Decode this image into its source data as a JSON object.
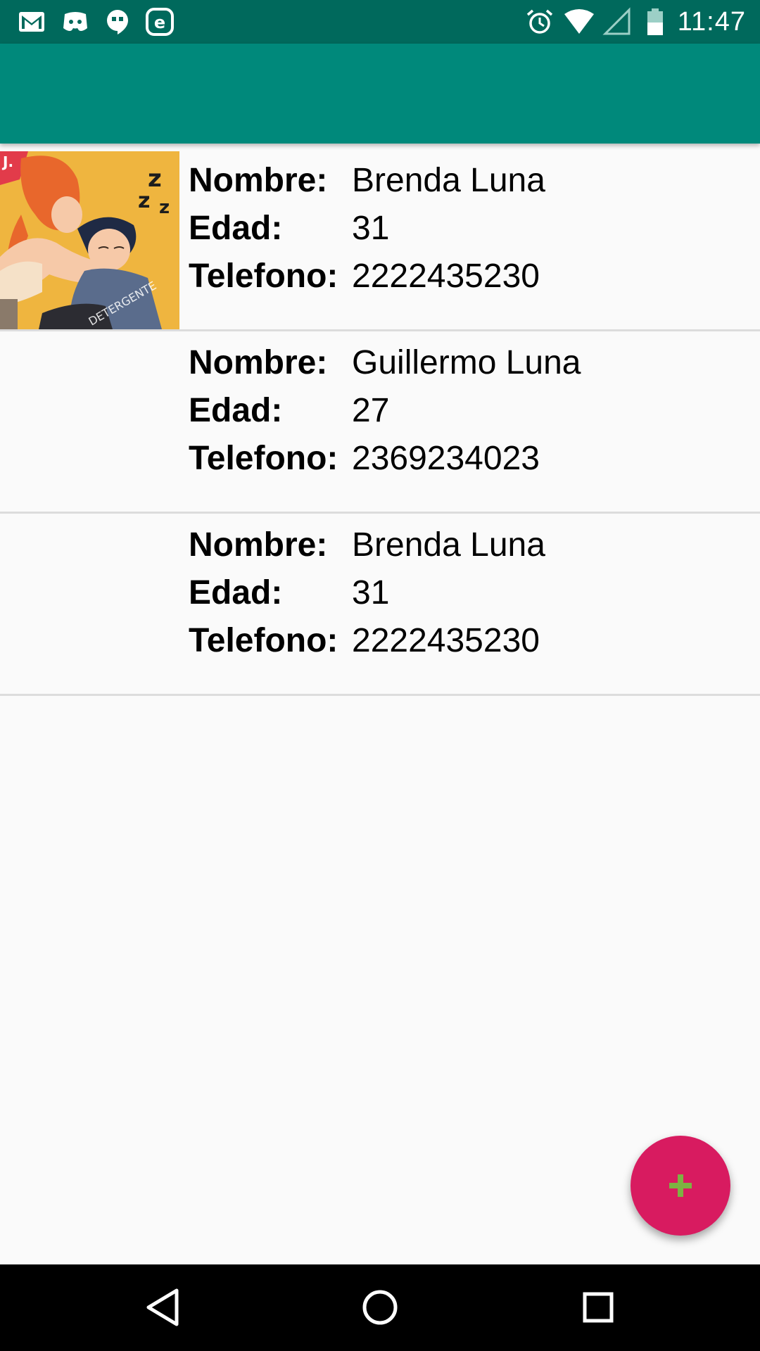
{
  "status_bar": {
    "time": "11:47",
    "left_icons": [
      "gmail-icon",
      "discord-icon",
      "hangouts-icon",
      "e-app-icon"
    ],
    "right_icons": [
      "alarm-icon",
      "wifi-icon",
      "cell-signal-icon",
      "battery-icon"
    ]
  },
  "app_bar": {
    "color": "#00897b",
    "status_color": "#00695c"
  },
  "contact_labels": {
    "name": "Nombre:",
    "age": "Edad:",
    "phone": "Telefono:"
  },
  "contacts": [
    {
      "name": "Brenda Luna",
      "age": "31",
      "phone": "2222435230",
      "has_photo": true
    },
    {
      "name": "Guillermo Luna",
      "age": "27",
      "phone": "2369234023",
      "has_photo": false
    },
    {
      "name": "Brenda Luna",
      "age": "31",
      "phone": "2222435230",
      "has_photo": false
    }
  ],
  "fab": {
    "icon": "plus-icon",
    "color": "#d81b60",
    "icon_color": "#7cb342"
  },
  "nav_bar": {
    "buttons": [
      "back-icon",
      "home-icon",
      "recents-icon"
    ]
  }
}
